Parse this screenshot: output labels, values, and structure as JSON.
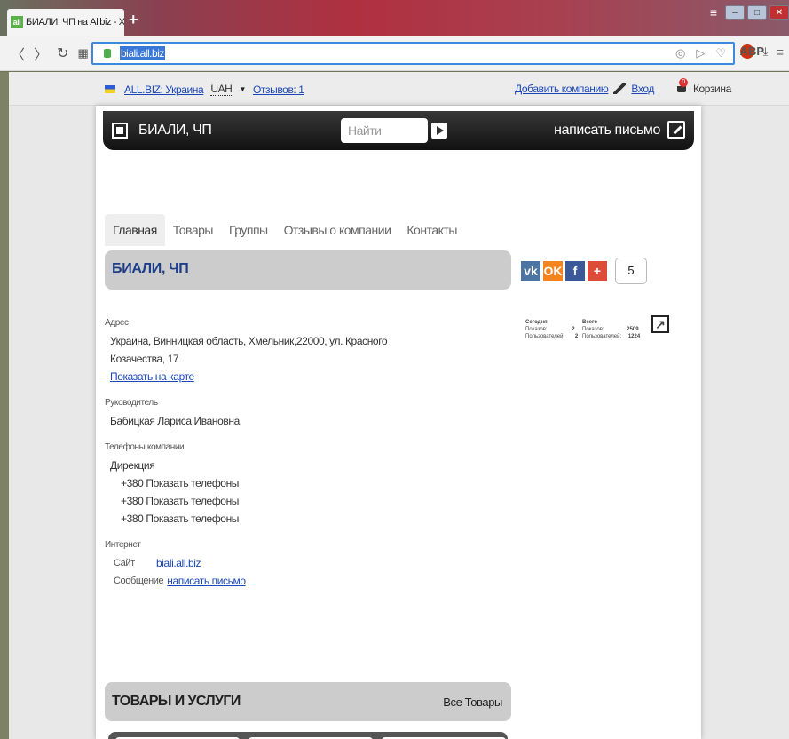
{
  "browser": {
    "tab_title": "БИАЛИ, ЧП на Allbiz - Хмельник",
    "tab_favicon": "all",
    "url": "biali.all.biz",
    "new_tab": "+",
    "tab_close": "X"
  },
  "topnav": {
    "site": "ALL.BIZ: Украина",
    "currency": "UAH",
    "reviews": "Отзывов: 1",
    "add_company": "Добавить компанию",
    "login": "Вход",
    "cart": "Корзина",
    "cart_count": "0"
  },
  "header": {
    "company": "БИАЛИ, ЧП",
    "search_placeholder": "Найти",
    "write_letter": "написать письмо"
  },
  "tabs": [
    {
      "label": "Главная"
    },
    {
      "label": "Товары"
    },
    {
      "label": "Группы"
    },
    {
      "label": "Отзывы о компании"
    },
    {
      "label": "Контакты"
    }
  ],
  "company_name": "БИАЛИ, ЧП",
  "social": {
    "vk": "vk",
    "ok": "OK",
    "fb": "f",
    "gp": "+",
    "count": "5"
  },
  "stats": {
    "today_label": "Сегодня",
    "total_label": "Всего",
    "views_label": "Показов:",
    "users_label": "Пользователей:",
    "today_views": "2",
    "today_users": "2",
    "total_views": "2509",
    "total_users": "1224"
  },
  "info": {
    "address_label": "Адрес",
    "address_line1": "Украина, Винницкая область, Хмельник,22000, ул. Красного",
    "address_line2": "Козачества, 17",
    "show_map": "Показать на карте",
    "manager_label": "Руководитель",
    "manager": "Бабицкая Лариса Ивановна",
    "phones_label": "Телефоны компании",
    "phone_group": "Дирекция",
    "phones": [
      "+380 Показать телефоны",
      "+380 Показать телефоны",
      "+380 Показать телефоны"
    ],
    "internet_label": "Интернет",
    "site_key": "Сайт",
    "site_value": "biali.all.biz",
    "message_key": "Сообщение",
    "message_value": "написать письмо"
  },
  "goods": {
    "title": "ТОВАРЫ И УСЛУГИ",
    "all": "Все Товары"
  }
}
